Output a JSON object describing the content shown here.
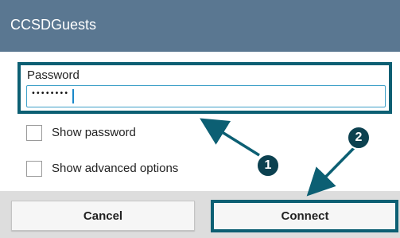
{
  "dialog": {
    "title": "CCSDGuests"
  },
  "password": {
    "label": "Password",
    "masked_value": "••••••••"
  },
  "options": [
    {
      "label": "Show password",
      "checked": false
    },
    {
      "label": "Show advanced options",
      "checked": false
    }
  ],
  "buttons": {
    "cancel_label": "Cancel",
    "connect_label": "Connect"
  },
  "annotations": {
    "step1_label": "1",
    "step2_label": "2",
    "highlight_color": "#0c5f73",
    "badge_color": "#0c4150"
  },
  "colors": {
    "titlebar": "#5a7791",
    "footer": "#dddddd",
    "input_border": "#3fa0c8"
  }
}
